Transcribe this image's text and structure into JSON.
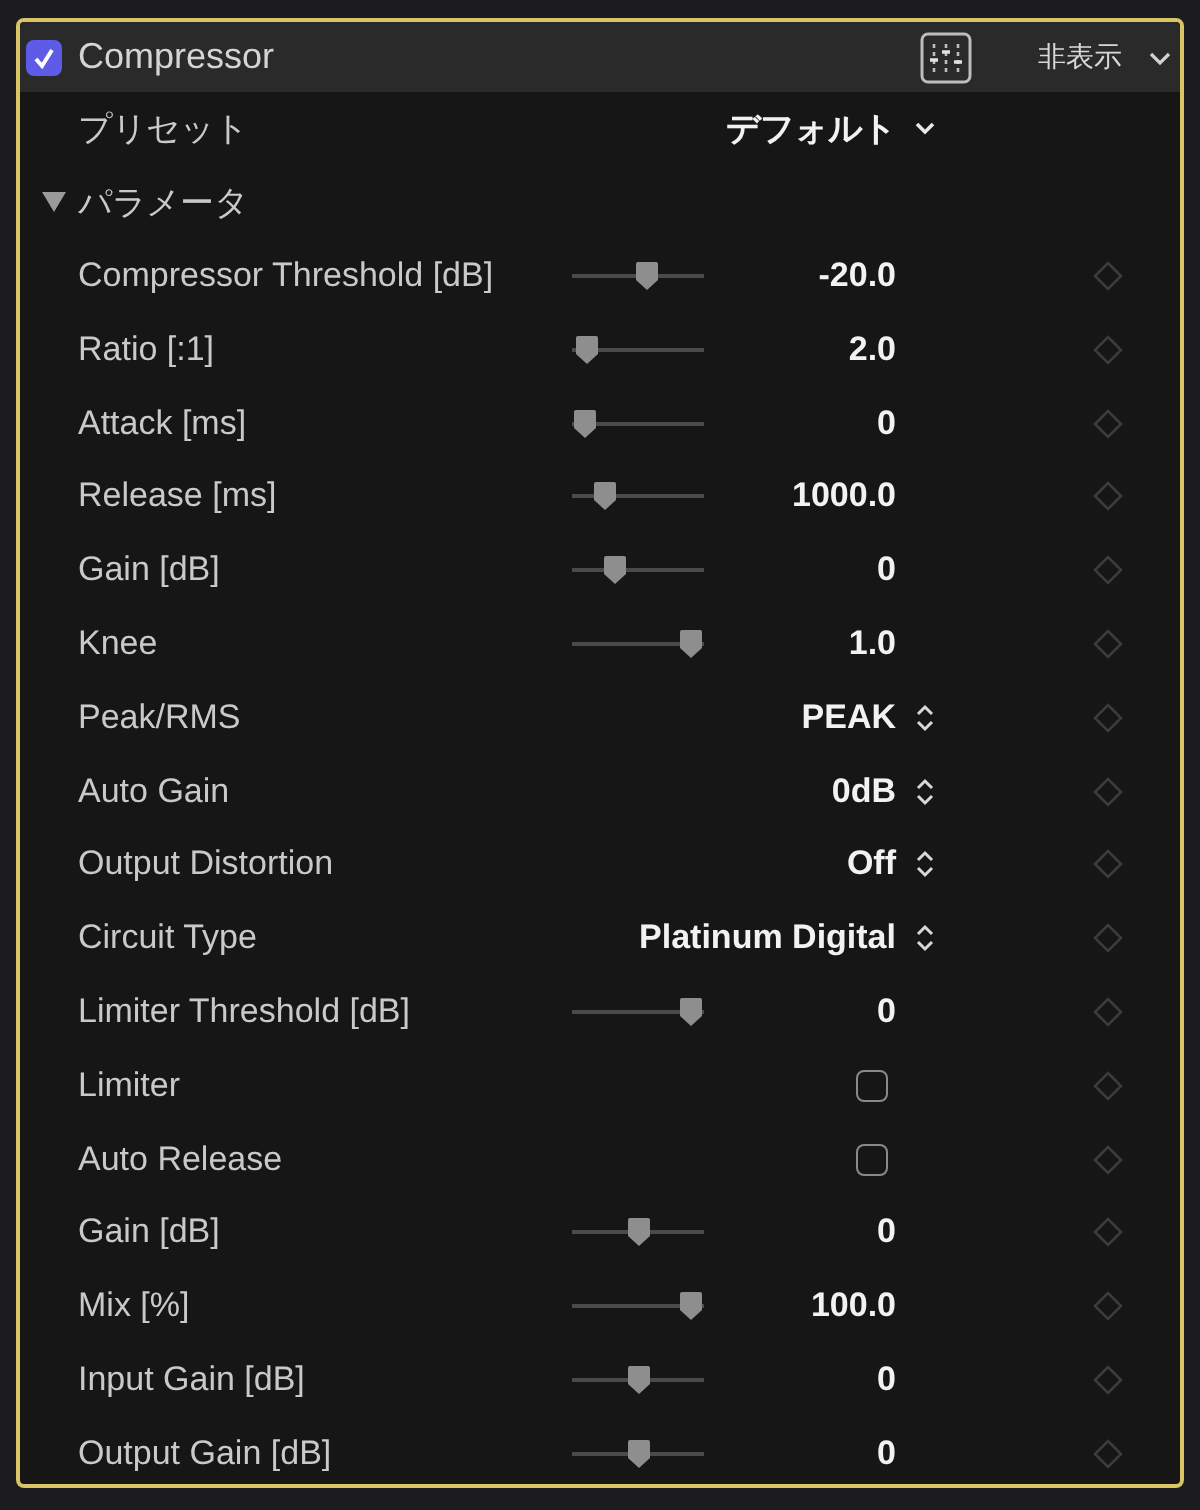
{
  "effect": {
    "enabled": true,
    "title": "Compressor",
    "visibility": "非表示"
  },
  "preset": {
    "label": "プリセット",
    "value": "デフォルト"
  },
  "section": {
    "label": "パラメータ",
    "expanded": true
  },
  "parameters": [
    {
      "kind": "slider",
      "label": "Compressor Threshold [dB]",
      "level": 0.59,
      "value": "-20.0"
    },
    {
      "kind": "slider",
      "label": "Ratio [:1]",
      "level": 0.02,
      "value": "2.0"
    },
    {
      "kind": "slider",
      "label": "Attack [ms]",
      "level": 0.0,
      "value": "0"
    },
    {
      "kind": "slider",
      "label": "Release [ms]",
      "level": 0.19,
      "value": "1000.0"
    },
    {
      "kind": "slider",
      "label": "Gain [dB]",
      "level": 0.28,
      "value": "0"
    },
    {
      "kind": "slider",
      "label": "Knee",
      "level": 1.0,
      "value": "1.0"
    },
    {
      "kind": "popup",
      "label": "Peak/RMS",
      "value": "PEAK"
    },
    {
      "kind": "popup",
      "label": "Auto Gain",
      "value": "0dB"
    },
    {
      "kind": "popup",
      "label": "Output Distortion",
      "value": "Off"
    },
    {
      "kind": "popup",
      "label": "Circuit Type",
      "value": "Platinum Digital"
    },
    {
      "kind": "slider",
      "label": "Limiter Threshold [dB]",
      "level": 1.0,
      "value": "0"
    },
    {
      "kind": "checkbox",
      "label": "Limiter",
      "checked": false
    },
    {
      "kind": "checkbox",
      "label": "Auto Release",
      "checked": false
    },
    {
      "kind": "slider",
      "label": "Gain [dB]",
      "level": 0.5,
      "value": "0"
    },
    {
      "kind": "slider",
      "label": "Mix [%]",
      "level": 1.0,
      "value": "100.0"
    },
    {
      "kind": "slider",
      "label": "Input Gain [dB]",
      "level": 0.5,
      "value": "0"
    },
    {
      "kind": "slider",
      "label": "Output Gain [dB]",
      "level": 0.5,
      "value": "0"
    }
  ]
}
